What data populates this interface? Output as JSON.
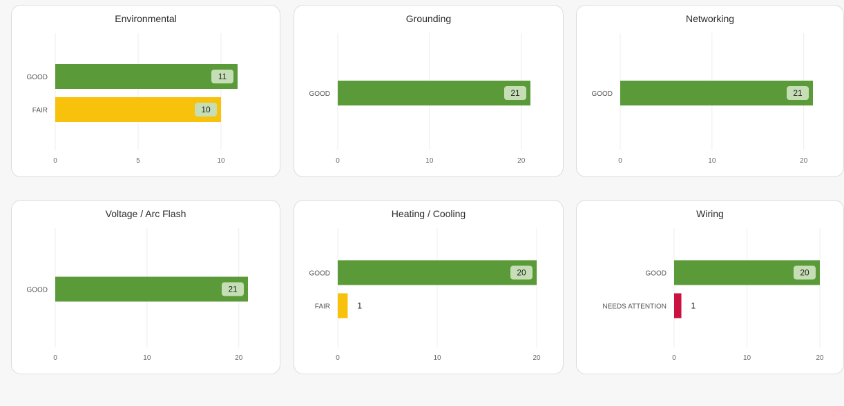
{
  "colors": {
    "GOOD": "#5b9a38",
    "FAIR": "#f8c20c",
    "NEEDS ATTENTION": "#c9123f",
    "grid": "#ececec",
    "badge": "#c6deb6"
  },
  "charts": [
    {
      "title": "Environmental",
      "chart_data": {
        "type": "bar",
        "orientation": "horizontal",
        "categories": [
          "GOOD",
          "FAIR"
        ],
        "values": [
          11,
          10
        ],
        "xticks": [
          0,
          5,
          10
        ],
        "xlim": [
          0,
          11
        ],
        "grid": true
      }
    },
    {
      "title": "Grounding",
      "chart_data": {
        "type": "bar",
        "orientation": "horizontal",
        "categories": [
          "GOOD"
        ],
        "values": [
          21
        ],
        "xticks": [
          0,
          10,
          20
        ],
        "xlim": [
          0,
          21
        ],
        "grid": true
      }
    },
    {
      "title": "Networking",
      "chart_data": {
        "type": "bar",
        "orientation": "horizontal",
        "categories": [
          "GOOD"
        ],
        "values": [
          21
        ],
        "xticks": [
          0,
          10,
          20
        ],
        "xlim": [
          0,
          21
        ],
        "grid": true
      }
    },
    {
      "title": "Voltage / Arc Flash",
      "chart_data": {
        "type": "bar",
        "orientation": "horizontal",
        "categories": [
          "GOOD"
        ],
        "values": [
          21
        ],
        "xticks": [
          0,
          10,
          20
        ],
        "xlim": [
          0,
          21
        ],
        "grid": true
      }
    },
    {
      "title": "Heating / Cooling",
      "chart_data": {
        "type": "bar",
        "orientation": "horizontal",
        "categories": [
          "GOOD",
          "FAIR"
        ],
        "values": [
          20,
          1
        ],
        "xticks": [
          0,
          10,
          20
        ],
        "xlim": [
          0,
          20
        ],
        "grid": true
      }
    },
    {
      "title": "Wiring",
      "chart_data": {
        "type": "bar",
        "orientation": "horizontal",
        "categories": [
          "GOOD",
          "NEEDS ATTENTION"
        ],
        "values": [
          20,
          1
        ],
        "xticks": [
          0,
          10,
          20
        ],
        "xlim": [
          0,
          20
        ],
        "grid": true
      }
    }
  ]
}
